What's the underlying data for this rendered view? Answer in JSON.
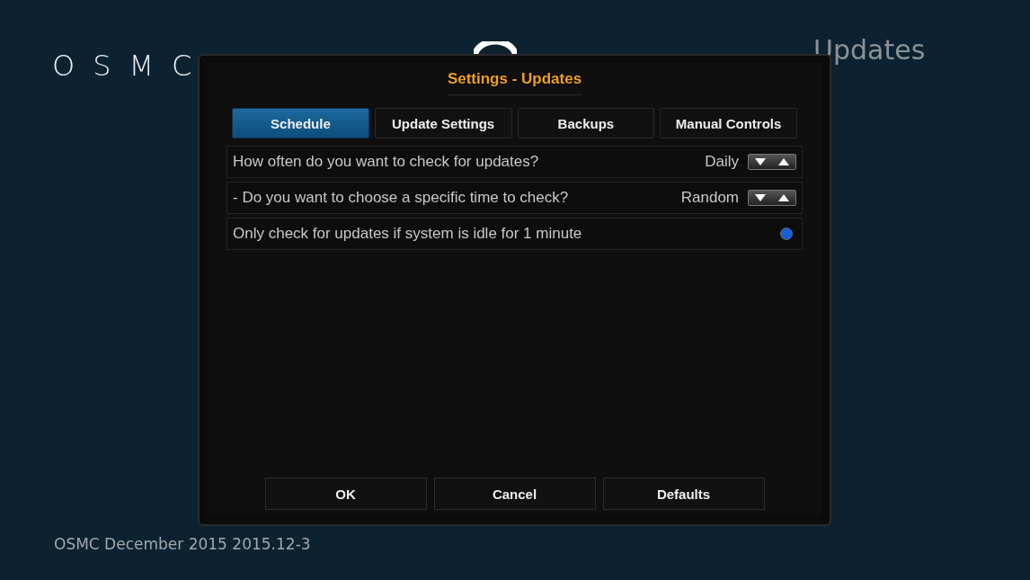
{
  "logo": "OSMC",
  "page_title": "Updates",
  "footer": "OSMC December 2015 2015.12-3",
  "dialog": {
    "title": "Settings - Updates",
    "tabs": [
      {
        "label": "Schedule",
        "selected": true
      },
      {
        "label": "Update Settings",
        "selected": false
      },
      {
        "label": "Backups",
        "selected": false
      },
      {
        "label": "Manual Controls",
        "selected": false
      }
    ],
    "settings": [
      {
        "kind": "spinner",
        "label": "How often do you want to check for updates?",
        "value": "Daily"
      },
      {
        "kind": "spinner",
        "label": "- Do you want to choose a specific time to check?",
        "value": "Random"
      },
      {
        "kind": "radio",
        "label": "Only check for updates if system is idle for 1 minute",
        "on": true
      }
    ],
    "buttons": [
      "OK",
      "Cancel",
      "Defaults"
    ]
  }
}
